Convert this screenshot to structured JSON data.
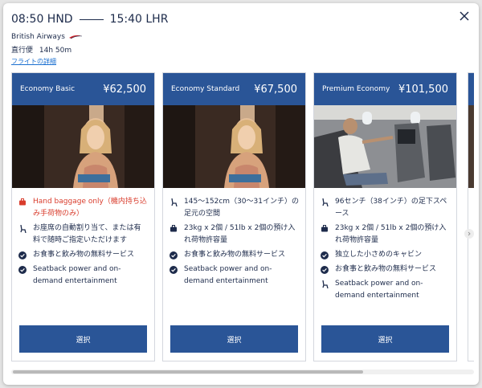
{
  "header": {
    "depart_time": "08:50 HND",
    "arrive_time": "15:40 LHR",
    "airline": "British Airways",
    "direct_label": "直行便",
    "duration": "14h 50m",
    "details_link": "フライトの詳細"
  },
  "icons": {
    "close": "close-icon",
    "baggage": "suitcase-icon",
    "seat": "seat-icon",
    "check": "check-circle-icon",
    "power": "power-icon",
    "arrow": "chevron-right-icon"
  },
  "colors": {
    "brand": "#2a5597",
    "warning": "#d93c2c",
    "link": "#1a6fd0",
    "text": "#1d2b4b"
  },
  "fares": [
    {
      "name": "Economy Basic",
      "price": "¥62,500",
      "features": [
        {
          "icon": "suitcase-icon",
          "text": "Hand baggage only（機内持ち込み手荷物のみ）",
          "warning": true
        },
        {
          "icon": "seat-icon",
          "text": "お座席の自動割り当て、または有料で随時ご指定いただけます",
          "warning": false
        },
        {
          "icon": "check-circle-icon",
          "text": "お食事と飲み物の無料サービス",
          "warning": false
        },
        {
          "icon": "check-circle-icon",
          "text": "Seatback power and on-demand entertainment",
          "warning": false
        }
      ],
      "button": "選択"
    },
    {
      "name": "Economy Standard",
      "price": "¥67,500",
      "features": [
        {
          "icon": "seat-icon",
          "text": "145～152cm（30～31インチ）の足元の空間",
          "warning": false
        },
        {
          "icon": "suitcase-icon",
          "text": "23kg x 2個 / 51lb x 2個の預け入れ荷物許容量",
          "warning": false
        },
        {
          "icon": "check-circle-icon",
          "text": "お食事と飲み物の無料サービス",
          "warning": false
        },
        {
          "icon": "check-circle-icon",
          "text": "Seatback power and on-demand entertainment",
          "warning": false
        }
      ],
      "button": "選択"
    },
    {
      "name": "Premium Economy",
      "price": "¥101,500",
      "features": [
        {
          "icon": "seat-icon",
          "text": "96センチ（38インチ）の足下スペース",
          "warning": false
        },
        {
          "icon": "suitcase-icon",
          "text": "23kg x 2個 / 51lb x 2個の預け入れ荷物許容量",
          "warning": false
        },
        {
          "icon": "check-circle-icon",
          "text": "独立した小さめのキャビン",
          "warning": false
        },
        {
          "icon": "check-circle-icon",
          "text": "お食事と飲み物の無料サービス",
          "warning": false
        },
        {
          "icon": "seat-icon",
          "text": "Seatback power and on-demand entertainment",
          "warning": false
        }
      ],
      "button": "選択"
    }
  ]
}
